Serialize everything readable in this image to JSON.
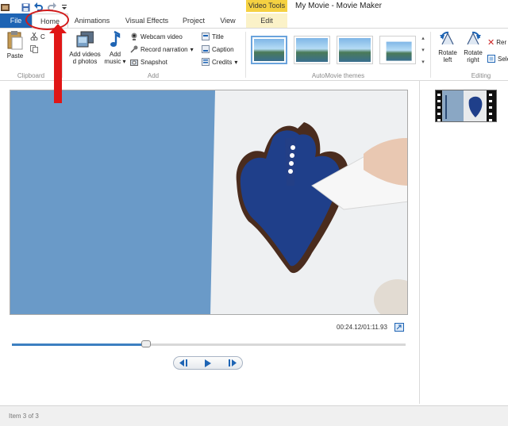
{
  "window": {
    "title": "My Movie - Movie Maker",
    "contextual_tab_header": "Video Tools"
  },
  "tabs": [
    {
      "label": "File"
    },
    {
      "label": "Home"
    },
    {
      "label": "Animations"
    },
    {
      "label": "Visual Effects"
    },
    {
      "label": "Project"
    },
    {
      "label": "View"
    },
    {
      "label": "Edit"
    }
  ],
  "ribbon": {
    "clipboard": {
      "group_label": "Clipboard",
      "paste": "Paste",
      "cut_partial": "C"
    },
    "add": {
      "group_label": "Add",
      "add_videos_line1": "Add videos",
      "add_videos_line2": "d photos",
      "add_music_line1": "Add",
      "add_music_line2": "music",
      "webcam": "Webcam video",
      "narration": "Record narration",
      "snapshot": "Snapshot",
      "title": "Title",
      "caption": "Caption",
      "credits": "Credits"
    },
    "themes": {
      "group_label": "AutoMovie themes"
    },
    "editing": {
      "group_label": "Editing",
      "rotate_left_line1": "Rotate",
      "rotate_left_line2": "left",
      "rotate_right_line1": "Rotate",
      "rotate_right_line2": "right",
      "remove_partial": "Rer",
      "select_partial": "Sele"
    }
  },
  "player": {
    "timecode": "00:24.12/01:11.93",
    "progress_fraction": 0.34
  },
  "status": {
    "text": "Item 3 of 3"
  },
  "colors": {
    "accent": "#1e64b4",
    "contextual": "#f5d142",
    "annotation": "#d21b1b"
  }
}
